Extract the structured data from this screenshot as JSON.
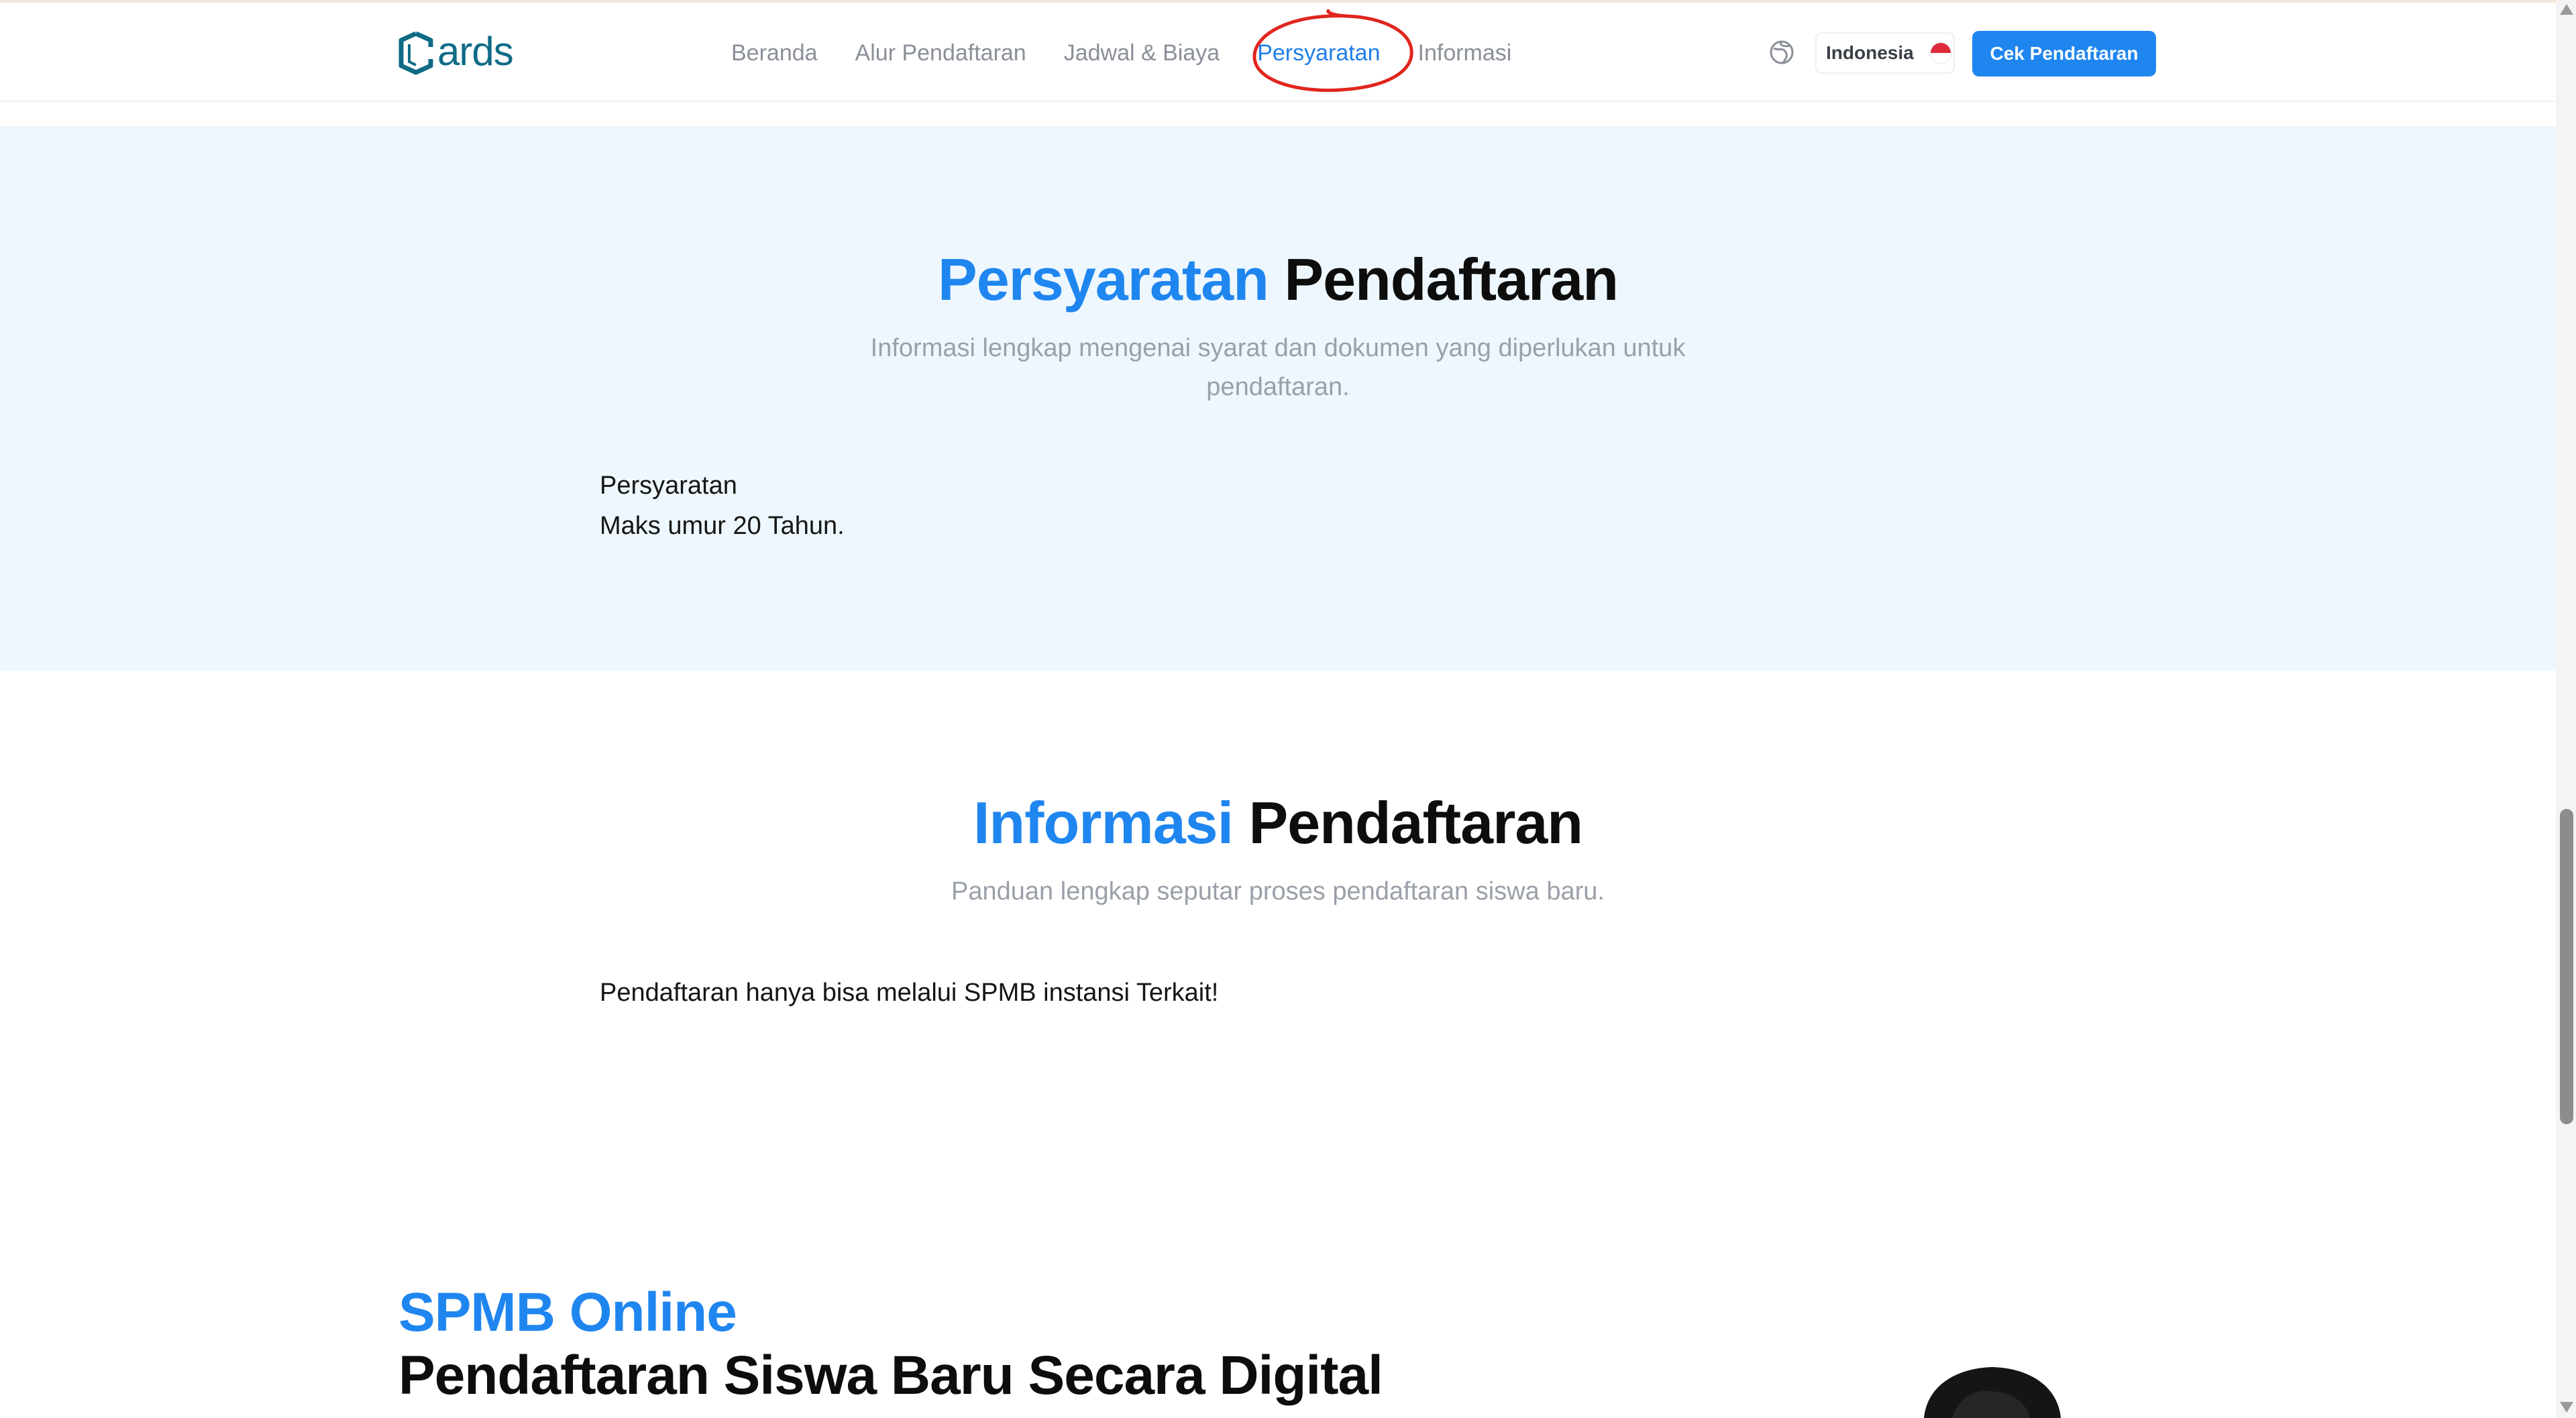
{
  "nav": {
    "logo_text": "ards",
    "links": [
      {
        "label": "Beranda"
      },
      {
        "label": "Alur Pendaftaran"
      },
      {
        "label": "Jadwal & Biaya"
      },
      {
        "label": "Persyaratan",
        "active": true
      },
      {
        "label": "Informasi"
      }
    ],
    "language": "Indonesia",
    "cta_label": "Cek Pendaftaran"
  },
  "requirements": {
    "title_accent": "Persyaratan",
    "title_rest": "Pendaftaran",
    "subtitle": "Informasi lengkap mengenai syarat dan dokumen yang diperlukan untuk pendaftaran.",
    "heading": "Persyaratan",
    "text": "Maks umur 20 Tahun."
  },
  "information": {
    "title_accent": "Informasi",
    "title_rest": "Pendaftaran",
    "subtitle": "Panduan lengkap seputar proses pendaftaran siswa baru.",
    "text": "Pendaftaran hanya bisa melalui SPMB instansi Terkait!"
  },
  "hero": {
    "kicker": "SPMB Online",
    "title": "Pendaftaran Siswa Baru Secara Digital"
  },
  "colors": {
    "accent": "#1f86f0",
    "logo": "#0f6b86",
    "section_bg": "#eef7fe",
    "annotation": "#e0261e"
  },
  "icons": [
    "cards-logo-icon",
    "globe-icon",
    "indonesia-flag-icon",
    "scroll-up-arrow-icon",
    "scroll-down-arrow-icon"
  ]
}
